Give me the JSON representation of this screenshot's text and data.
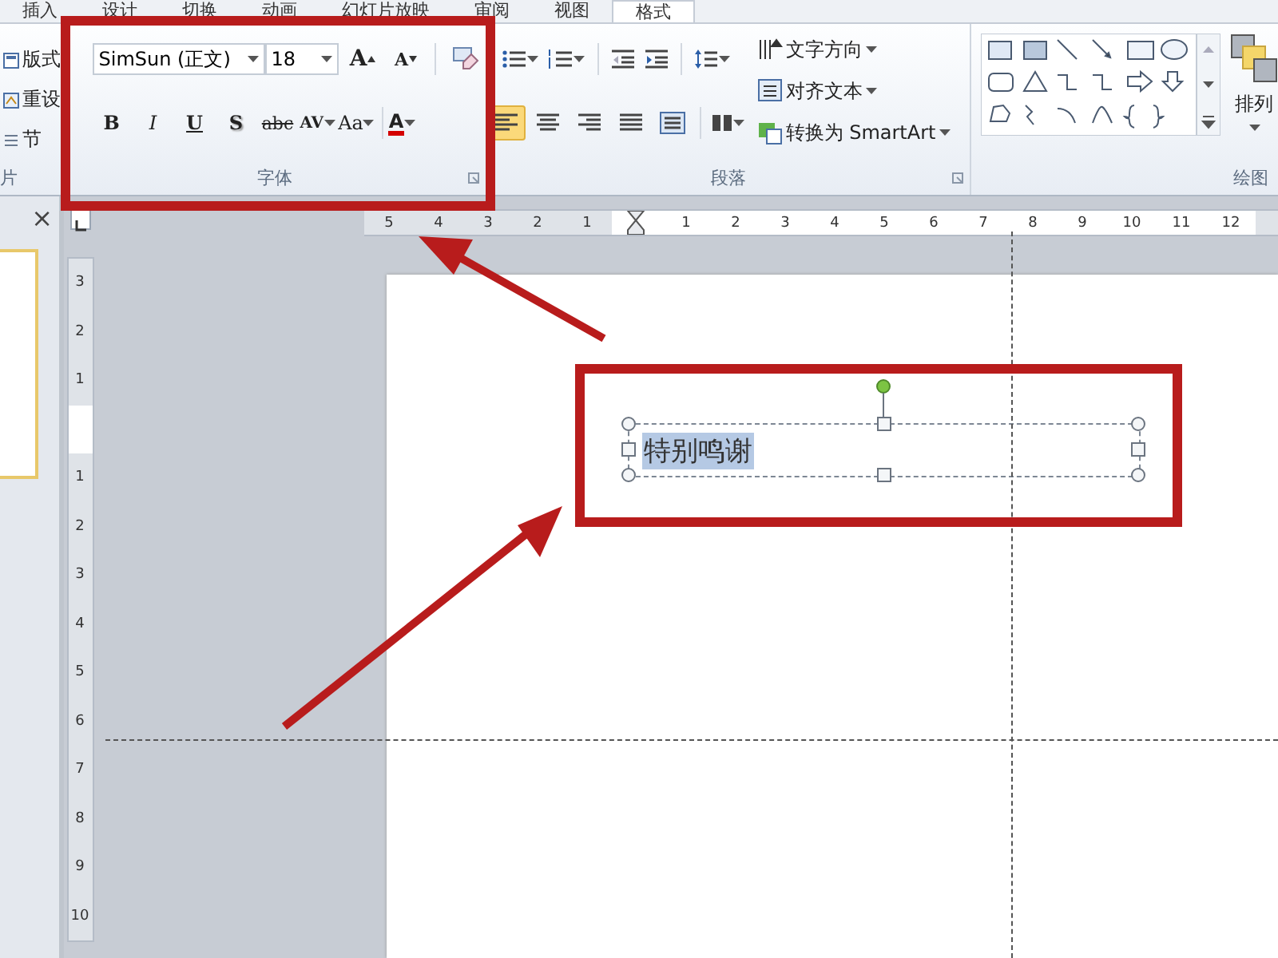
{
  "ribbon_tabs": [
    {
      "label": "插入",
      "selected": false
    },
    {
      "label": "设计",
      "selected": false
    },
    {
      "label": "切换",
      "selected": false
    },
    {
      "label": "动画",
      "selected": false
    },
    {
      "label": "幻灯片放映",
      "selected": false
    },
    {
      "label": "审阅",
      "selected": false
    },
    {
      "label": "视图",
      "selected": false
    },
    {
      "label": "格式",
      "selected": true
    }
  ],
  "slides_group": {
    "commands": [
      {
        "label": "版式",
        "kind": "layout"
      },
      {
        "label": "重设",
        "kind": "reset"
      },
      {
        "label": "节",
        "kind": "section"
      }
    ],
    "label": "片"
  },
  "font_group": {
    "font_name": "SimSun (正文)",
    "font_size": "18",
    "size_buttons": [
      {
        "label": "A",
        "kind": "grow"
      },
      {
        "label": "A",
        "kind": "shrink"
      }
    ],
    "format_buttons": [
      {
        "label": "B",
        "kind": "bold"
      },
      {
        "label": "I",
        "kind": "italic"
      },
      {
        "label": "U",
        "kind": "underline"
      },
      {
        "label": "S",
        "kind": "shadow"
      },
      {
        "label": "abc",
        "kind": "strike"
      },
      {
        "label": "AV",
        "kind": "spacing"
      },
      {
        "label": "Aa",
        "kind": "case"
      },
      {
        "label": "A",
        "kind": "color"
      }
    ],
    "label": "字体"
  },
  "paragraph_group": {
    "align_buttons": [
      {
        "kind": "left",
        "selected": true
      },
      {
        "kind": "center",
        "selected": false
      },
      {
        "kind": "right",
        "selected": false
      },
      {
        "kind": "justify",
        "selected": false
      },
      {
        "kind": "distributed",
        "selected": false
      }
    ],
    "commands": [
      {
        "label": "文字方向",
        "kind": "direction"
      },
      {
        "label": "对齐文本",
        "kind": "align"
      },
      {
        "label": "转换为 SmartArt",
        "kind": "smartart"
      }
    ],
    "label": "段落"
  },
  "drawing_group": {
    "arrange": "排列",
    "label": "绘图"
  },
  "horizontal_ruler": {
    "left_labels": [
      "5",
      "4",
      "3",
      "2",
      "1"
    ],
    "right_labels": [
      "1",
      "2",
      "3",
      "4",
      "5",
      "6",
      "7",
      "8",
      "9",
      "10",
      "11",
      "12"
    ]
  },
  "vertical_ruler": {
    "top_labels": [
      "3",
      "2",
      "1"
    ],
    "bottom_labels": [
      "1",
      "2",
      "3",
      "4",
      "5",
      "6",
      "7",
      "8",
      "9",
      "10"
    ]
  },
  "pane_close": "×",
  "text_box": {
    "text": "特别鸣谢",
    "selected": true
  }
}
